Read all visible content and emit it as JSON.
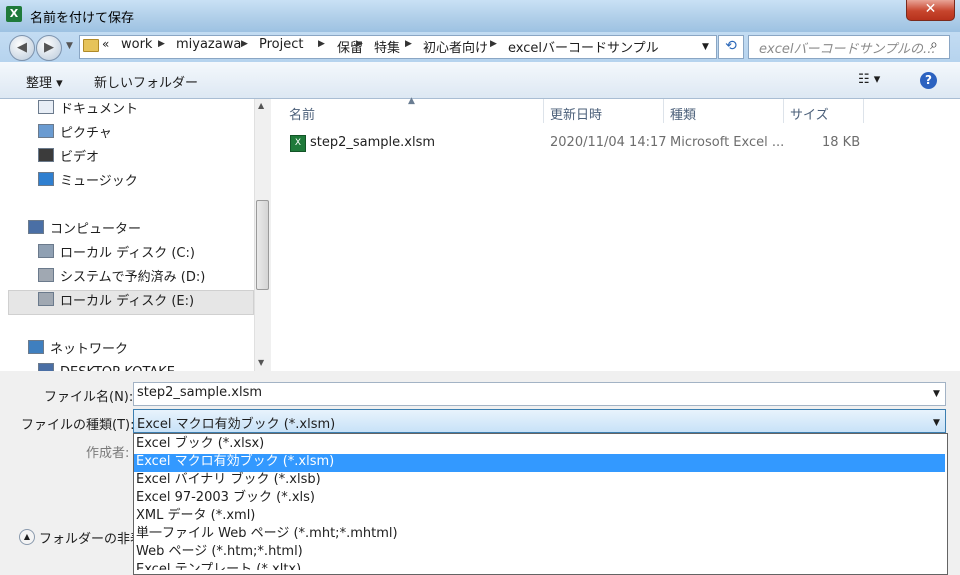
{
  "window": {
    "title": "名前を付けて保存",
    "close_label": "✕"
  },
  "address": {
    "chevron": "«",
    "crumbs": [
      "work",
      "miyazawa",
      "Project",
      "保留",
      "特集",
      "初心者向け",
      "excelバーコードサンプル"
    ],
    "search_placeholder": "excelバーコードサンプルの..."
  },
  "toolbar": {
    "organize": "整理 ▾",
    "new_folder": "新しいフォルダー",
    "view": "☷ ▾",
    "help": "?"
  },
  "nav": {
    "items": [
      "ドキュメント",
      "ピクチャ",
      "ビデオ",
      "ミュージック",
      "コンピューター",
      "ローカル ディスク (C:)",
      "システムで予約済み (D:)",
      "ローカル ディスク (E:)",
      "ネットワーク",
      "DESKTOP-KOTAKE"
    ]
  },
  "file_list": {
    "columns": [
      "名前",
      "更新日時",
      "種類",
      "サイズ"
    ],
    "rows": [
      {
        "name": "step2_sample.xlsm",
        "modified": "2020/11/04 14:17",
        "type": "Microsoft Excel ...",
        "size": "18 KB"
      }
    ]
  },
  "form": {
    "filename_label": "ファイル名(N):",
    "filename_value": "step2_sample.xlsm",
    "filetype_label": "ファイルの種類(T):",
    "filetype_value": "Excel マクロ有効ブック (*.xlsm)",
    "author_label": "作成者:",
    "hide_folders": "フォルダーの非表"
  },
  "filetype_options": [
    "Excel ブック (*.xlsx)",
    "Excel マクロ有効ブック (*.xlsm)",
    "Excel バイナリ ブック (*.xlsb)",
    "Excel 97-2003 ブック (*.xls)",
    "XML データ (*.xml)",
    "単一ファイル Web ページ (*.mht;*.mhtml)",
    "Web ページ (*.htm;*.html)",
    "Excel テンプレート (*.xltx)"
  ],
  "selected_option_index": 1,
  "colors": {
    "selection": "#3399ff",
    "titlebar": "#aecde8",
    "close": "#c7452d"
  }
}
